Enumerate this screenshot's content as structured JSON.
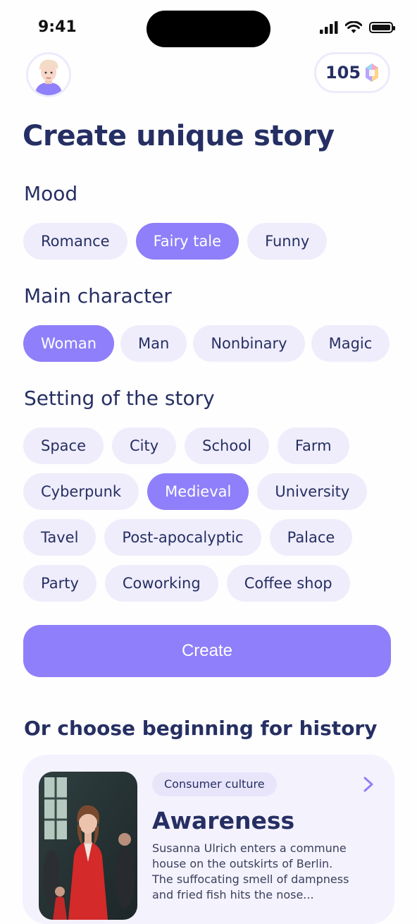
{
  "status_bar": {
    "time": "9:41"
  },
  "header": {
    "coins": "105",
    "avatar_icon": "user-avatar-icon",
    "gem_icon": "crystal-gem-icon"
  },
  "title": "Create unique story",
  "mood": {
    "title": "Mood",
    "options": [
      "Romance",
      "Fairy tale",
      "Funny"
    ],
    "selected": "Fairy tale"
  },
  "main_character": {
    "title": "Main character",
    "options": [
      "Woman",
      "Man",
      "Nonbinary",
      "Magic"
    ],
    "selected": "Woman"
  },
  "setting": {
    "title": "Setting of the story",
    "options": [
      "Space",
      "City",
      "School",
      "Farm",
      "Cyberpunk",
      "Medieval",
      "University",
      "Tavel",
      "Post-apocalyptic",
      "Palace",
      "Party",
      "Coworking",
      "Coffee shop"
    ],
    "selected": "Medieval"
  },
  "create_button": "Create",
  "beginnings": {
    "title": "Or choose beginning for history",
    "card": {
      "tag": "Consumer culture",
      "title": "Awareness",
      "description": "Susanna Ulrich enters a commune house on the outskirts of Berlin. The suffocating smell of dampness and fried fish hits the nose..."
    }
  },
  "colors": {
    "accent": "#8f7ffa",
    "chip_bg": "#efedfb",
    "text_dark": "#262f63"
  }
}
